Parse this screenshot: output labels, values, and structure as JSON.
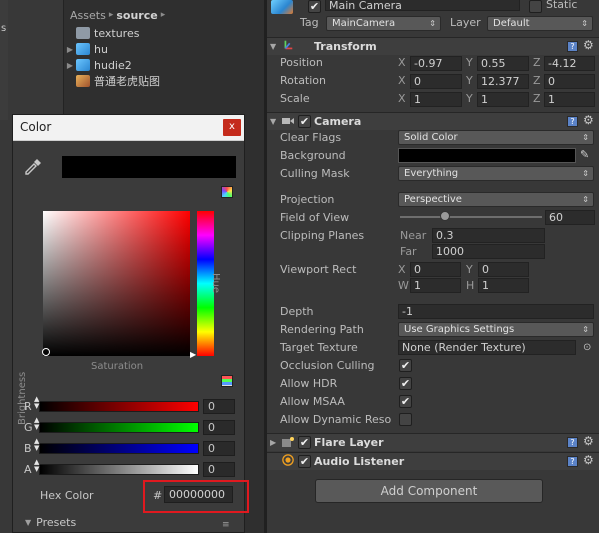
{
  "left_strip": {
    "label": "s"
  },
  "project": {
    "breadcrumb": [
      "Assets",
      "source"
    ],
    "items": [
      {
        "label": "textures",
        "icon": "folder-icon",
        "expandable": false
      },
      {
        "label": "hu",
        "icon": "model-icon",
        "expandable": true
      },
      {
        "label": "hudie2",
        "icon": "model-icon",
        "expandable": true
      },
      {
        "label": "普通老虎贴图",
        "icon": "image-icon",
        "expandable": false
      }
    ]
  },
  "color_picker": {
    "title": "Color",
    "close": "x",
    "brightness_label": "Brightness",
    "hue_label": "Hue",
    "saturation_label": "Saturation",
    "channels": [
      {
        "label": "R",
        "value": "0",
        "color": "#ff0000"
      },
      {
        "label": "G",
        "value": "0",
        "color": "#00ff00"
      },
      {
        "label": "B",
        "value": "0",
        "color": "#0000ff"
      },
      {
        "label": "A",
        "value": "0",
        "color": "#ffffff"
      }
    ],
    "hex_label": "Hex Color",
    "hex_hash": "#",
    "hex_value": "00000000",
    "presets_label": "Presets",
    "presets_menu": "≡"
  },
  "inspector": {
    "game_object": {
      "name": "Main Camera",
      "static_label": "Static",
      "tag_label": "Tag",
      "tag_value": "MainCamera",
      "layer_label": "Layer",
      "layer_value": "Default"
    },
    "transform": {
      "title": "Transform",
      "position": {
        "label": "Position",
        "x": "-0.97",
        "y": "0.55",
        "z": "-4.12"
      },
      "rotation": {
        "label": "Rotation",
        "x": "0",
        "y": "12.377",
        "z": "0"
      },
      "scale": {
        "label": "Scale",
        "x": "1",
        "y": "1",
        "z": "1"
      }
    },
    "camera": {
      "title": "Camera",
      "clear_flags": {
        "label": "Clear Flags",
        "value": "Solid Color"
      },
      "background": {
        "label": "Background",
        "color": "#000000"
      },
      "culling_mask": {
        "label": "Culling Mask",
        "value": "Everything"
      },
      "projection": {
        "label": "Projection",
        "value": "Perspective"
      },
      "fov": {
        "label": "Field of View",
        "value": "60"
      },
      "clipping": {
        "label": "Clipping Planes",
        "near_label": "Near",
        "near": "0.3",
        "far_label": "Far",
        "far": "1000"
      },
      "viewport": {
        "label": "Viewport Rect",
        "x": "0",
        "y": "0",
        "w": "1",
        "h": "1"
      },
      "depth": {
        "label": "Depth",
        "value": "-1"
      },
      "rendering_path": {
        "label": "Rendering Path",
        "value": "Use Graphics Settings"
      },
      "target_texture": {
        "label": "Target Texture",
        "value": "None (Render Texture)"
      },
      "occlusion": {
        "label": "Occlusion Culling",
        "checked": "✔"
      },
      "hdr": {
        "label": "Allow HDR",
        "checked": "✔"
      },
      "msaa": {
        "label": "Allow MSAA",
        "checked": "✔"
      },
      "dynamic": {
        "label": "Allow Dynamic Reso",
        "checked": ""
      }
    },
    "flare_layer": {
      "title": "Flare Layer"
    },
    "audio_listener": {
      "title": "Audio Listener"
    },
    "add_component": "Add Component",
    "axes": {
      "x": "X",
      "y": "Y",
      "z": "Z",
      "w": "W",
      "h": "H"
    },
    "help_glyph": "?",
    "gear_glyph": "⚙",
    "check_glyph": "✔"
  }
}
